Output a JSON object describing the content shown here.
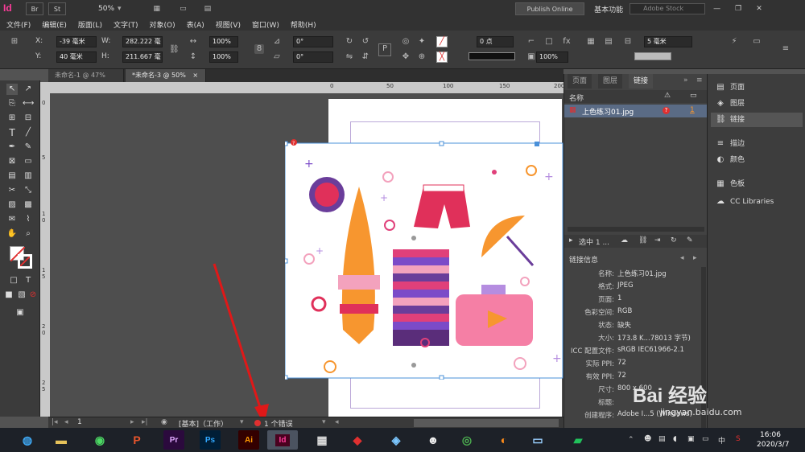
{
  "titlebar": {
    "logo": "Id",
    "btn_br": "Br",
    "btn_st": "St",
    "zoom": "50%",
    "publish_online": "Publish Online",
    "workspace": "基本功能",
    "search_placeholder": "Adobe Stock"
  },
  "menu": [
    "文件(F)",
    "编辑(E)",
    "版面(L)",
    "文字(T)",
    "对象(O)",
    "表(A)",
    "视图(V)",
    "窗口(W)",
    "帮助(H)"
  ],
  "control": {
    "x_label": "X:",
    "x_value": "-39 毫米",
    "y_label": "Y:",
    "y_value": "40 毫米",
    "w_label": "W:",
    "w_value": "282.222 毫",
    "h_label": "H:",
    "h_value": "211.667 毫",
    "scale_x": "100%",
    "scale_y": "100%",
    "angle": "0°",
    "shear": "0°",
    "stroke_weight": "0 点",
    "opacity": "100%",
    "offset": "5 毫米"
  },
  "doc_tabs": [
    {
      "label": "未命名-1 @ 47%",
      "active": false
    },
    {
      "label": "*未命名-3 @ 50%",
      "active": true
    }
  ],
  "ruler_top": [
    "0",
    "50",
    "100",
    "150",
    "200"
  ],
  "ruler_left": [
    "0",
    "5",
    "1 0",
    "1 5",
    "2 0",
    "2 5"
  ],
  "status": {
    "page": "1",
    "style": "[基本]（工作）",
    "errors": "1 个错误"
  },
  "links_panel": {
    "tabs": [
      "页面",
      "图层",
      "链接"
    ],
    "col_name": "名称",
    "file_name": "上色练习01.jpg",
    "file_page": "1",
    "selection": "选中 1 ...",
    "info_header": "链接信息",
    "info": [
      {
        "k": "名称:",
        "v": "上色练习01.jpg"
      },
      {
        "k": "格式:",
        "v": "JPEG"
      },
      {
        "k": "页面:",
        "v": "1"
      },
      {
        "k": "色彩空间:",
        "v": "RGB"
      },
      {
        "k": "状态:",
        "v": "缺失"
      },
      {
        "k": "大小:",
        "v": "173.8 K...78013 字节)"
      },
      {
        "k": "ICC 配置文件:",
        "v": "sRGB IEC61966-2.1"
      },
      {
        "k": "实际 PPI:",
        "v": "72"
      },
      {
        "k": "有效 PPI:",
        "v": "72"
      },
      {
        "k": "尺寸:",
        "v": "800 x 600"
      },
      {
        "k": "标题:",
        "v": ""
      },
      {
        "k": "创建程序:",
        "v": "Adobe I...5 (Windows)"
      }
    ]
  },
  "dock": [
    "页面",
    "图层",
    "链接",
    "描边",
    "颜色",
    "色板",
    "CC Libraries"
  ],
  "taskbar": {
    "apps": [
      "Pr",
      "Ps",
      "Ai",
      "Id"
    ],
    "time": "16:06",
    "date": "2020/3/7"
  },
  "watermark": {
    "brand": "Bai 经验",
    "url": "jingyan.baidu.com"
  },
  "colors": {
    "accent": "#ff3c9b",
    "error": "#e03030",
    "selection": "#4a90d9"
  }
}
